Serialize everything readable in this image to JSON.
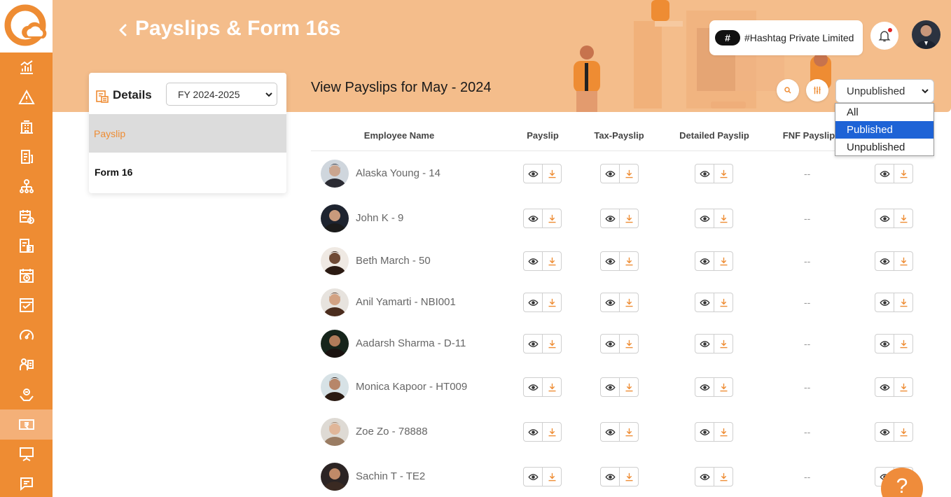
{
  "header": {
    "title": "Payslips & Form 16s",
    "company_badge": "#",
    "company_name": "#Hashtag Private Limited",
    "view_title": "View Payslips for May - 2024",
    "status_filter": {
      "selected": "Unpublished",
      "options": [
        "All",
        "Published",
        "Unpublished"
      ],
      "highlighted": "Published"
    }
  },
  "details": {
    "title": "Details",
    "financial_year": "FY 2024-2025",
    "tabs": [
      "Payslip",
      "Form 16"
    ],
    "active_tab": "Payslip"
  },
  "table": {
    "columns": [
      "Employee Name",
      "Payslip",
      "Tax-Payslip",
      "Detailed Payslip",
      "FNF Payslip"
    ],
    "rows": [
      {
        "name": "Alaska Young - 14",
        "fnf": "--"
      },
      {
        "name": "John K - 9",
        "fnf": "--"
      },
      {
        "name": "Beth March - 50",
        "fnf": "--"
      },
      {
        "name": "Anil Yamarti - NBI001",
        "fnf": "--"
      },
      {
        "name": "Aadarsh Sharma - D-11",
        "fnf": "--"
      },
      {
        "name": "Monica Kapoor - HT009",
        "fnf": "--"
      },
      {
        "name": "Zoe Zo - 78888",
        "fnf": "--"
      },
      {
        "name": "Sachin T - TE2",
        "fnf": "--"
      }
    ]
  },
  "help_label": "?",
  "sidebar_icons": [
    "analytics-icon",
    "alert-icon",
    "organization-icon",
    "tax-icon",
    "hierarchy-icon",
    "attendance-icon",
    "expense-icon",
    "timesheet-icon",
    "reports-icon",
    "performance-icon",
    "tasks-icon",
    "benefits-icon",
    "payroll-icon",
    "training-icon",
    "helpdesk-icon"
  ],
  "colors": {
    "accent": "#ee8c33",
    "banner": "#f4bd8b",
    "active_nav": "#f4b078",
    "dropdown_highlight": "#1e63d6"
  }
}
